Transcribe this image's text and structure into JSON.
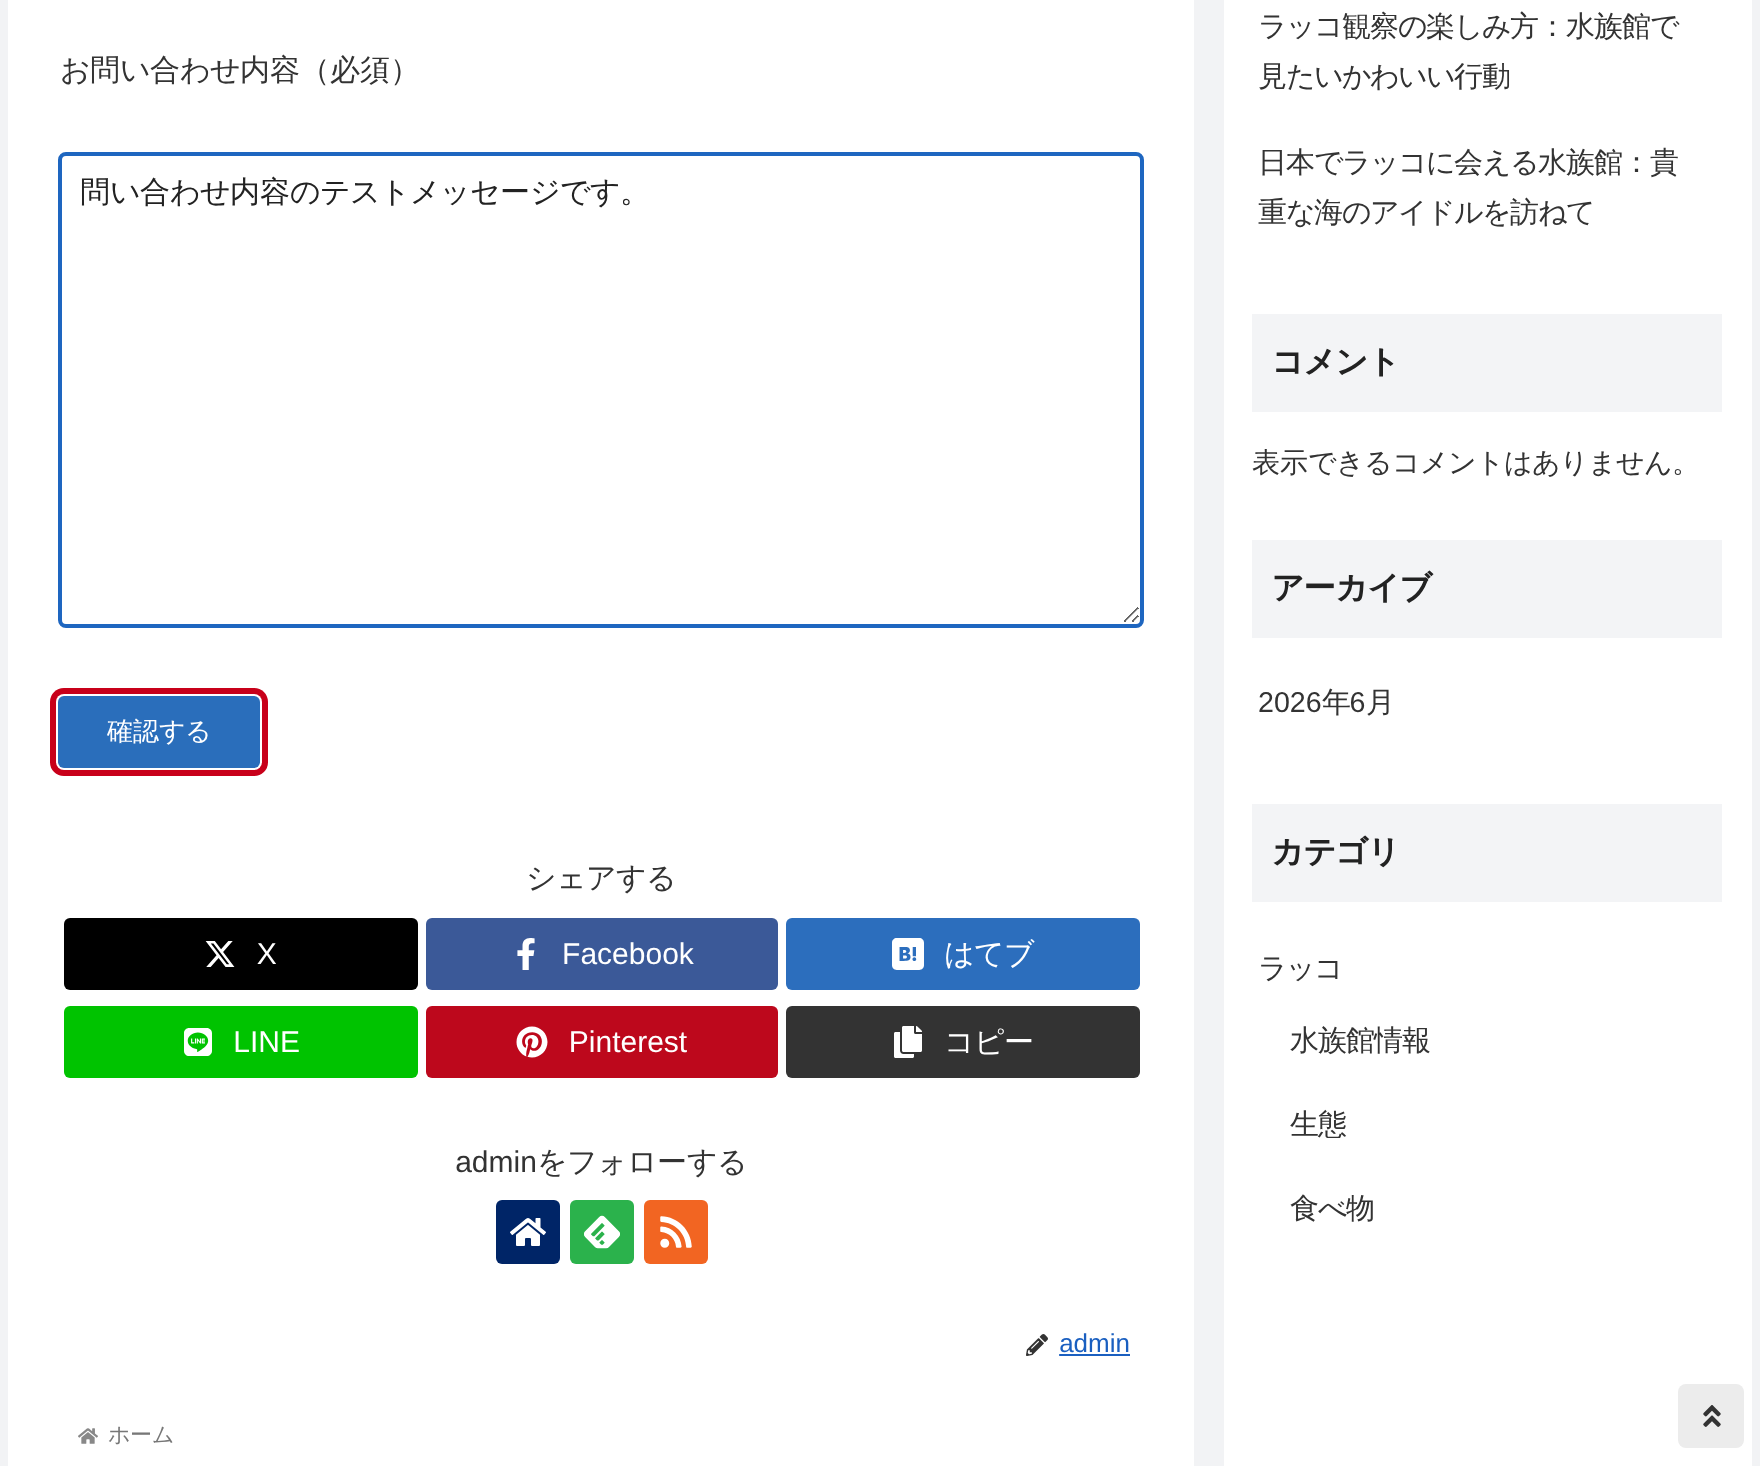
{
  "contact_form": {
    "label": "お問い合わせ内容（必須）",
    "message": {
      "value": "問い合わせ内容のテストメッセージです。"
    },
    "submit_button": {
      "label": "確認する",
      "highlighted": true
    }
  },
  "share": {
    "title": "シェアする",
    "buttons": [
      {
        "kind": "x",
        "label": "X"
      },
      {
        "kind": "facebook",
        "label": "Facebook"
      },
      {
        "kind": "hatena",
        "label": "はてブ"
      },
      {
        "kind": "line",
        "label": "LINE"
      },
      {
        "kind": "pinterest",
        "label": "Pinterest"
      },
      {
        "kind": "copy",
        "label": "コピー"
      }
    ]
  },
  "follow": {
    "title": "adminをフォローする",
    "buttons": [
      {
        "kind": "home"
      },
      {
        "kind": "feedly"
      },
      {
        "kind": "rss"
      }
    ]
  },
  "author": {
    "name": "admin"
  },
  "breadcrumb": [
    {
      "label": "ホーム"
    }
  ],
  "sidebar": {
    "recent_posts": [
      "ラッコ観察の楽しみ方：水族館で見たいかわいい行動",
      "日本でラッコに会える水族館：貴重な海のアイドルを訪ねて"
    ],
    "comments": {
      "title": "コメント",
      "empty_text": "表示できるコメントはありません。"
    },
    "archive": {
      "title": "アーカイブ",
      "items": [
        "2026年6月"
      ]
    },
    "categories": {
      "title": "カテゴリ",
      "items": [
        {
          "label": "ラッコ",
          "children": [
            {
              "label": "水族館情報"
            },
            {
              "label": "生態"
            },
            {
              "label": "食べ物"
            }
          ]
        }
      ]
    }
  }
}
